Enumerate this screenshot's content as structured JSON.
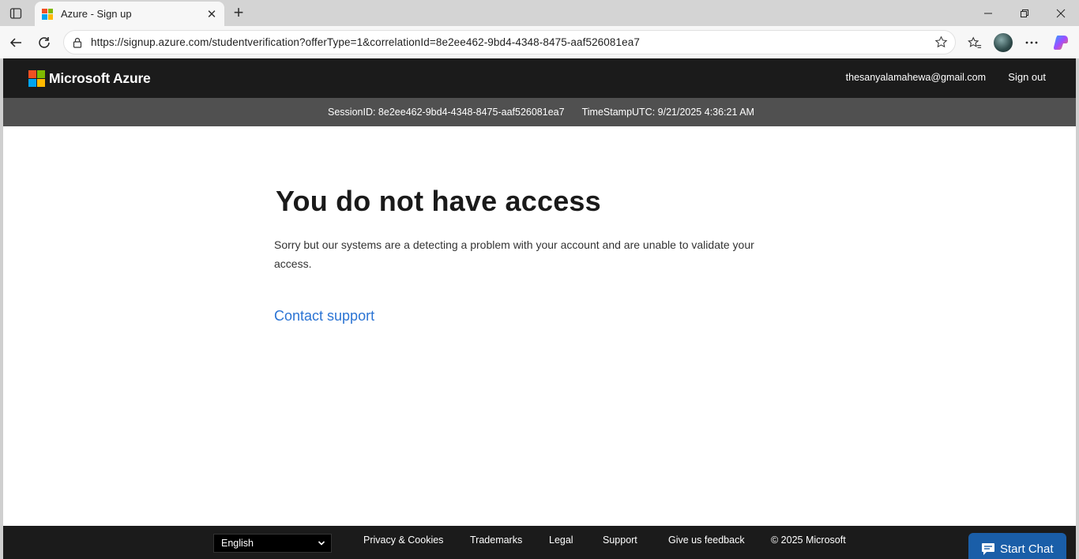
{
  "browser": {
    "tab_title": "Azure - Sign up",
    "url": "https://signup.azure.com/studentverification?offerType=1&correlationId=8e2ee462-9bd4-4348-8475-aaf526081ea7"
  },
  "header": {
    "brand": "Microsoft Azure",
    "user_email": "thesanyalamahewa@gmail.com",
    "sign_out": "Sign out"
  },
  "session": {
    "session_id": "SessionID: 8e2ee462-9bd4-4348-8475-aaf526081ea7",
    "timestamp": "TimeStampUTC: 9/21/2025 4:36:21 AM"
  },
  "main": {
    "title": "You do not have access",
    "message": "Sorry but our systems are a detecting a problem with your account and are unable to validate your access.",
    "contact_link": "Contact support"
  },
  "footer": {
    "language": "English",
    "links": [
      "Privacy & Cookies",
      "Trademarks",
      "Legal",
      "Support",
      "Give us feedback"
    ],
    "copyright": "© 2025 Microsoft",
    "chat": "Start Chat"
  },
  "colors": {
    "ms_red": "#f25022",
    "ms_green": "#7fba00",
    "ms_blue": "#00a4ef",
    "ms_yellow": "#ffb900",
    "link": "#2b74d4",
    "chat_button": "#1a5ea8"
  }
}
